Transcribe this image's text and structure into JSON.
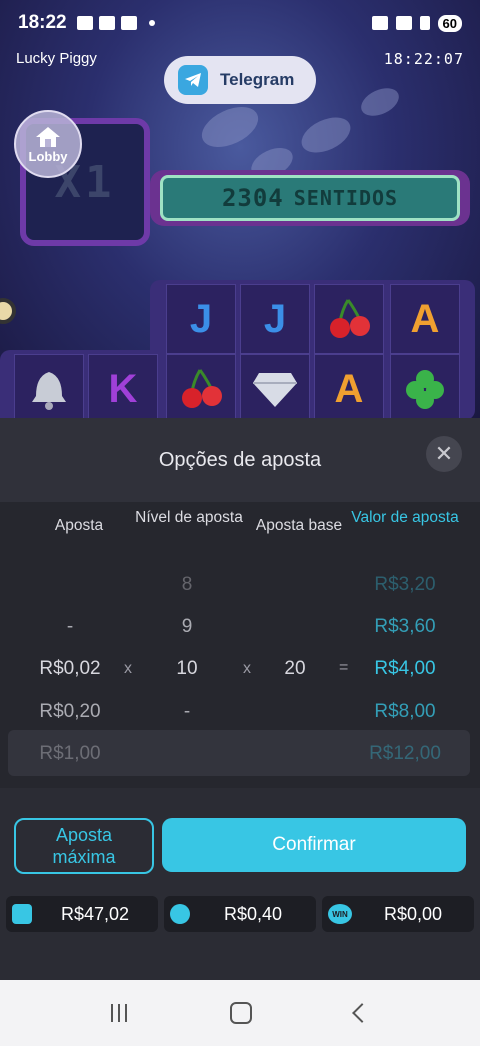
{
  "status_bar": {
    "time": "18:22",
    "battery": "60"
  },
  "game": {
    "name": "Lucky Piggy",
    "clock": "18:22:07",
    "telegram_label": "Telegram",
    "lobby_label": "Lobby",
    "multiplier": "X1",
    "ways_count": "2304",
    "ways_label": "SENTIDOS",
    "reel_symbols": [
      "J",
      "J",
      "cherry",
      "A",
      "bell",
      "K",
      "cherry",
      "diamond",
      "A",
      "clover"
    ]
  },
  "sheet": {
    "title": "Opções de aposta",
    "columns": [
      "Aposta",
      "Nível de aposta",
      "Aposta base",
      "Valor de aposta"
    ],
    "bet": {
      "above": [
        "",
        "-"
      ],
      "selected": "R$0,02",
      "below": [
        "R$0,20",
        "R$1,00"
      ]
    },
    "level": {
      "above": [
        "8",
        "9"
      ],
      "selected": "10",
      "below": [
        "-",
        ""
      ]
    },
    "base": {
      "selected": "20"
    },
    "value": {
      "above": [
        "R$3,20",
        "R$3,60"
      ],
      "selected": "R$4,00",
      "below": [
        "R$8,00",
        "R$12,00"
      ]
    },
    "operators": {
      "times": "x",
      "equals": "="
    },
    "max_bet_label": "Aposta máxima",
    "confirm_label": "Confirmar"
  },
  "stats": {
    "balance": "R$47,02",
    "bet": "R$0,40",
    "win": "R$0,00",
    "win_icon_text": "WIN"
  },
  "colors": {
    "accent": "#38c6e4",
    "sheet_bg": "#2b2c34"
  }
}
